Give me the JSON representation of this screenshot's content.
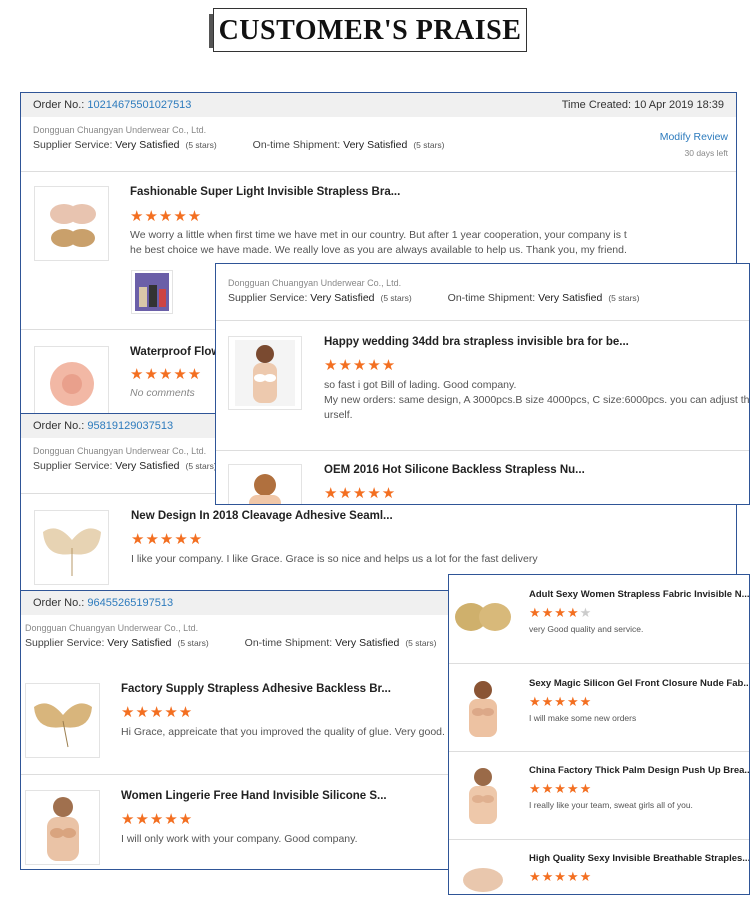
{
  "header": {
    "title": "CUSTOMER'S PRAISE"
  },
  "card1": {
    "order_label": "Order No.:",
    "order_no": "10214675501027513",
    "time_created": "Time Created: 10 Apr 2019 18:39",
    "supplier": "Dongguan Chuangyan Underwear Co., Ltd.",
    "service_label": "Supplier Service:",
    "service_value": "Very Satisfied",
    "service_stars": "(5 stars)",
    "shipment_label": "On-time Shipment:",
    "shipment_value": "Very Satisfied",
    "shipment_stars": "(5 stars)",
    "modify": "Modify Review",
    "days_left": "30 days left",
    "items": [
      {
        "title": "Fashionable Super Light Invisible Strapless Bra...",
        "rating": 5,
        "comment": "We worry a little when first time we have met in our country. But after 1 year cooperation, your company is t",
        "comment2": "he best choice we have made. We really love as you are always available to help us. Thank you, my friend."
      },
      {
        "title": "Waterproof Flow",
        "rating": 5,
        "comment": "No comments"
      }
    ]
  },
  "card2": {
    "supplier": "Dongguan Chuangyan Underwear Co., Ltd.",
    "service_label": "Supplier Service:",
    "service_value": "Very Satisfied",
    "service_stars": "(5 stars)",
    "shipment_label": "On-time Shipment:",
    "shipment_value": "Very Satisfied",
    "shipment_stars": "(5 stars)",
    "items": [
      {
        "title": "Happy wedding 34dd bra strapless invisible bra for be...",
        "rating": 5,
        "comment": "so fast i got Bill of lading. Good company.",
        "comment2": "My new orders: same design, A 3000pcs.B size 4000pcs, C size:6000pcs. you can adjust the c",
        "comment3": "urself."
      },
      {
        "title": "OEM 2016 Hot Silicone Backless Strapless Nu...",
        "rating": 5
      }
    ]
  },
  "card3": {
    "order_label": "Order No.:",
    "order_no": "95819129037513",
    "supplier": "Dongguan Chuangyan Underwear Co., Ltd.",
    "service_label": "Supplier Service:",
    "service_value": "Very Satisfied",
    "service_stars": "(5 stars)",
    "items": [
      {
        "title": "New Design In 2018 Cleavage Adhesive Seaml...",
        "rating": 5,
        "comment": "I like your company. I like Grace. Grace is so nice and helps us a lot for the fast delivery"
      }
    ]
  },
  "card4": {
    "order_label": "Order No.:",
    "order_no": "96455265197513",
    "supplier": "Dongguan Chuangyan Underwear Co., Ltd.",
    "service_label": "Supplier Service:",
    "service_value": "Very Satisfied",
    "service_stars": "(5 stars)",
    "shipment_label": "On-time Shipment:",
    "shipment_value": "Very Satisfied",
    "shipment_stars": "(5 stars)",
    "items": [
      {
        "title": "Factory Supply Strapless Adhesive Backless Br...",
        "rating": 5,
        "comment": "Hi Grace, appreicate that you improved the quality of glue. Very good."
      },
      {
        "title": "Women Lingerie Free Hand Invisible Silicone S...",
        "rating": 5,
        "comment": "I will only work with your company. Good company."
      }
    ]
  },
  "card5": {
    "items": [
      {
        "title": "Adult Sexy Women Strapless Fabric Invisible N...",
        "rating": 4,
        "comment": "very Good quality and service."
      },
      {
        "title": "Sexy Magic Silicon Gel Front Closure Nude Fab...",
        "rating": 5,
        "comment": "I will make some new orders"
      },
      {
        "title": "China Factory Thick Palm Design Push Up Brea...",
        "rating": 5,
        "comment": "I really like your team, sweat girls all of you."
      },
      {
        "title": "High Quality Sexy Invisible Breathable Straples...",
        "rating": 5
      }
    ]
  },
  "colors": {
    "accent": "#f36f21",
    "link": "#2d7bbd",
    "border": "#2f5597"
  }
}
